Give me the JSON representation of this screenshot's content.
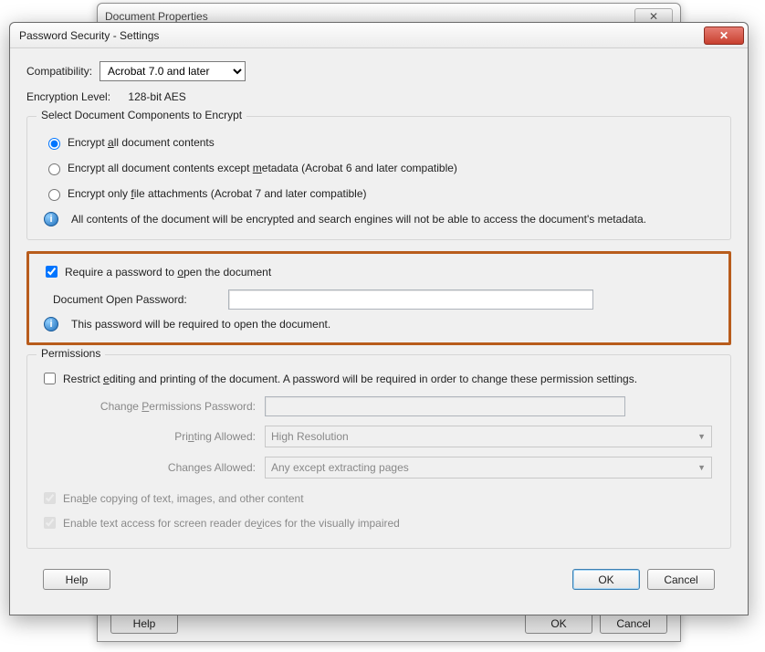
{
  "parent": {
    "title": "Document Properties",
    "close_glyph": "✕",
    "help": "Help",
    "ok": "OK",
    "cancel": "Cancel"
  },
  "dialog": {
    "title": "Password Security - Settings",
    "close_glyph": "✕"
  },
  "compat": {
    "label": "Compatibility:",
    "value": "Acrobat 7.0 and later"
  },
  "level": {
    "label": "Encryption  Level:",
    "value": "128-bit AES"
  },
  "encrypt_group": {
    "legend": "Select Document Components to Encrypt",
    "opt_all": {
      "pre": "Encrypt ",
      "u": "a",
      "post": "ll document contents"
    },
    "opt_meta": {
      "pre": "Encrypt all document contents except ",
      "u": "m",
      "post": "etadata (Acrobat 6 and later compatible)"
    },
    "opt_file": {
      "pre": "Encrypt only ",
      "u": "f",
      "post": "ile attachments (Acrobat 7 and later compatible)"
    },
    "info_glyph": "i",
    "info": "All contents of the document will be encrypted and search engines will not be able to access the document's metadata."
  },
  "open_pw": {
    "check": {
      "pre": "Require a password to ",
      "u": "o",
      "post": "pen the document"
    },
    "label": "Document Open Password:",
    "value": "",
    "info": "This password will be required to open the document."
  },
  "perm": {
    "legend": "Permissions",
    "restrict": {
      "pre": "Restrict ",
      "u": "e",
      "post": "diting and printing of the document. A password will be required in order to change these permission settings."
    },
    "change_label": {
      "pre": "Change ",
      "u": "P",
      "post": "ermissions Password:"
    },
    "change_value": "",
    "print_label": {
      "pre": "Pri",
      "u": "n",
      "post": "ting Allowed:"
    },
    "print_value": "High Resolution",
    "changes_label": {
      "pre": "Chan",
      "u": "g",
      "post": "es Allowed:"
    },
    "changes_value": "Any except extracting pages",
    "copy": {
      "pre": "Ena",
      "u": "b",
      "post": "le copying of text, images, and other content"
    },
    "access": {
      "pre": "Enable text access for screen reader de",
      "u": "v",
      "post": "ices for the visually impaired"
    }
  },
  "footer": {
    "help": "Help",
    "ok": "OK",
    "cancel": "Cancel"
  }
}
